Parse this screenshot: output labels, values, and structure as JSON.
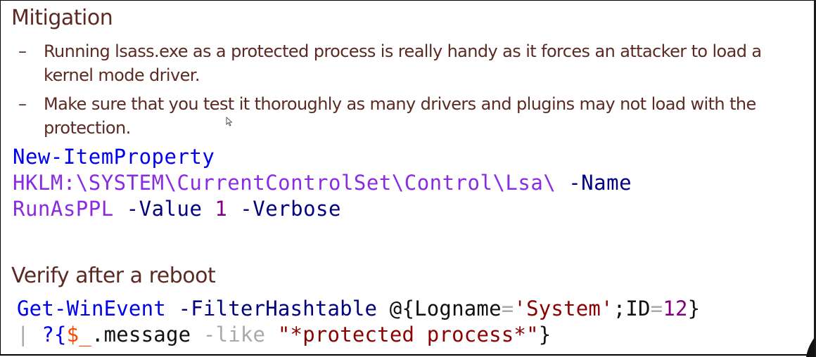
{
  "slide": {
    "title": "Mitigation",
    "bullets": [
      {
        "dash": "–",
        "line1": "Running lsass.exe as a protected process is really handy as it forces an attacker to load a",
        "line2": "kernel mode driver."
      },
      {
        "dash": "–",
        "line1": "Make sure that you test it thoroughly as many drivers and plugins may not load with the",
        "line2": "protection."
      }
    ],
    "code1": {
      "line1": "New-ItemProperty",
      "line2_path": "HKLM:\\SYSTEM\\CurrentControlSet\\Control\\Lsa\\",
      "line2_param": " -Name",
      "line3_name": "RunAsPPL",
      "line3_value_flag": " -Value ",
      "line3_value": "1",
      "line3_verbose": " -Verbose"
    },
    "section2_title": "Verify after a reboot",
    "code2": {
      "cmd": "Get-WinEvent",
      "param": " -FilterHashtable ",
      "open": "@{Logname",
      "eq1": "=",
      "str1": "'System'",
      "semi": ";ID",
      "eq2": "=",
      "num": "12",
      "close": "}",
      "pipe": "| ",
      "where": "?{",
      "var": "$_",
      "member": ".message ",
      "op": "-like ",
      "str2": "\"*protected process*\"",
      "end": "}"
    }
  },
  "colors": {
    "text_brown": "#5b2a22",
    "cmdlet_blue": "#0000ee",
    "path_purple": "#8a2be2",
    "param_navy": "#000080",
    "string_darkred": "#8b0000",
    "variable_orange": "#ff4500"
  },
  "icons": {
    "cursor": "mouse-pointer-icon"
  }
}
